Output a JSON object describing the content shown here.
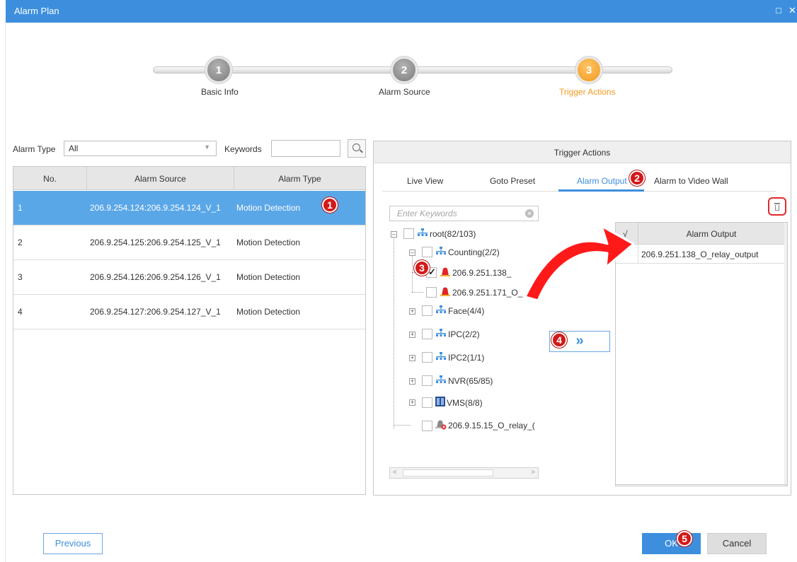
{
  "window": {
    "title": "Alarm Plan",
    "restore_glyph": "□",
    "close_glyph": "✕"
  },
  "steps": [
    {
      "number": "1",
      "label": "Basic Info"
    },
    {
      "number": "2",
      "label": "Alarm Source"
    },
    {
      "number": "3",
      "label": "Trigger Actions"
    }
  ],
  "filter": {
    "alarm_type_label": "Alarm Type",
    "alarm_type_value": "All",
    "keywords_label": "Keywords",
    "keywords_value": ""
  },
  "alarm_table": {
    "headers": [
      "No.",
      "Alarm Source",
      "Alarm Type"
    ],
    "rows": [
      {
        "no": "1",
        "source": "206.9.254.124:206.9.254.124_V_1",
        "type": "Motion Detection"
      },
      {
        "no": "2",
        "source": "206.9.254.125:206.9.254.125_V_1",
        "type": "Motion Detection"
      },
      {
        "no": "3",
        "source": "206.9.254.126:206.9.254.126_V_1",
        "type": "Motion Detection"
      },
      {
        "no": "4",
        "source": "206.9.254.127:206.9.254.127_V_1",
        "type": "Motion Detection"
      }
    ]
  },
  "trigger": {
    "title": "Trigger Actions",
    "tabs": [
      "Live View",
      "Goto Preset",
      "Alarm Output",
      "Alarm to Video Wall"
    ],
    "active_tab": "Alarm Output",
    "search_placeholder": "Enter Keywords",
    "add_glyph": "»",
    "tree": {
      "root": "root(82/103)",
      "counting": "Counting(2/2)",
      "counting_children": [
        "206.9.251.138_",
        "206.9.251.171_O_"
      ],
      "face": "Face(4/4)",
      "ipc": "IPC(2/2)",
      "ipc2": "IPC2(1/1)",
      "nvr": "NVR(65/85)",
      "vms": "VMS(8/8)",
      "relay": "206.9.15.15_O_relay_("
    },
    "output_table": {
      "check_header": "√",
      "header": "Alarm Output",
      "rows": [
        "206.9.251.138_O_relay_output"
      ]
    }
  },
  "buttons": {
    "previous": "Previous",
    "ok": "OK",
    "cancel": "Cancel"
  },
  "annotations": [
    "1",
    "2",
    "3",
    "4",
    "5"
  ],
  "colors": {
    "accent": "#3d8fde",
    "selected_row": "#5aa7e8",
    "step_active": "#f29a1f",
    "annotation": "#d31818"
  }
}
